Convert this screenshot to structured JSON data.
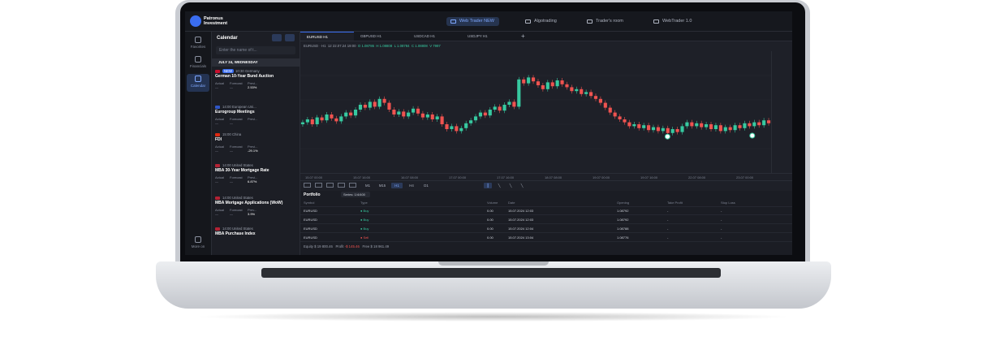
{
  "brand": {
    "line1": "Patronus",
    "line2": "Investment"
  },
  "nav_tabs": [
    {
      "label": "Web Trader NEW",
      "active": true
    },
    {
      "label": "Algotrading",
      "active": false
    },
    {
      "label": "Trader's room",
      "active": false
    },
    {
      "label": "WebTrader 1.0",
      "active": false
    }
  ],
  "rail": [
    {
      "label": "Favorites",
      "icon": "star-icon"
    },
    {
      "label": "Financials",
      "icon": "search-icon"
    },
    {
      "label": "Calendar",
      "icon": "calendar-icon",
      "active": true
    },
    {
      "label": "More on",
      "icon": "gear-icon"
    }
  ],
  "calendar": {
    "title": "Calendar",
    "search_placeholder": "Enter the name of t...",
    "date_label": "JULY 24, WEDNESDAY",
    "events": [
      {
        "time": "10:30",
        "badge": "NEW",
        "country": "Germany",
        "name": "German 10-Year Bund Auction",
        "actual": "Actual",
        "forecast": "Forecast",
        "prev": "Previ...",
        "prev_val": "2.53%",
        "flag": "#c8102e"
      },
      {
        "time": "14:00",
        "badge": "",
        "country": "European Uni...",
        "name": "Eurogroup Meetings",
        "actual": "Actual",
        "forecast": "Forecast",
        "prev": "Previ...",
        "prev_val": "",
        "flag": "#2f56c5"
      },
      {
        "time": "15:00",
        "badge": "",
        "country": "China",
        "name": "FDI",
        "actual": "Actual",
        "forecast": "Forecast",
        "prev": "Previ...",
        "prev_val": "-29.1%",
        "flag": "#de2910"
      },
      {
        "time": "14:00",
        "badge": "",
        "country": "United States",
        "name": "MBA 30-Year Mortgage Rate",
        "actual": "Actual",
        "forecast": "Forecast",
        "prev": "Previ...",
        "prev_val": "6.87%",
        "flag": "#b22234"
      },
      {
        "time": "14:00",
        "badge": "",
        "country": "United States",
        "name": "MBA Mortgage Applications (WoW)",
        "actual": "Actual",
        "forecast": "Forecast",
        "prev": "Prev...",
        "prev_val": "3.9%",
        "flag": "#b22234"
      },
      {
        "time": "14:00",
        "badge": "",
        "country": "United States",
        "name": "MBA Purchase Index",
        "actual": "",
        "forecast": "",
        "prev": "",
        "prev_val": "",
        "flag": "#b22234"
      }
    ]
  },
  "chart_tabs": [
    "EURUSD H1",
    "GBPUSD H1",
    "USDCAD H1",
    "USDJPY H1"
  ],
  "ohlc": {
    "symbol": "EURUSD · H1",
    "time": "12 22.07.24 19:00",
    "o": "O 1.08786",
    "h": "H 1.08808",
    "l": "L 1.08784",
    "c": "C 1.08808",
    "v": "V 7997"
  },
  "x_ticks": [
    "15.07 00:00",
    "15.07 16:00",
    "16.07 08:00",
    "17.07 00:00",
    "17.07 16:00",
    "18.07 08:00",
    "19.07 00:00",
    "19.07 16:00",
    "22.07 08:00",
    "23.07 00:00"
  ],
  "toolbar_tf": [
    "M1",
    "M15",
    "H1",
    "H4",
    "D1"
  ],
  "chart_data": {
    "type": "candlestick",
    "series": "EURUSD H1",
    "closes": [
      0.42,
      0.45,
      0.4,
      0.47,
      0.44,
      0.5,
      0.46,
      0.43,
      0.48,
      0.52,
      0.49,
      0.55,
      0.6,
      0.57,
      0.63,
      0.58,
      0.66,
      0.62,
      0.55,
      0.5,
      0.53,
      0.48,
      0.52,
      0.56,
      0.51,
      0.47,
      0.5,
      0.45,
      0.48,
      0.4,
      0.35,
      0.38,
      0.33,
      0.36,
      0.41,
      0.44,
      0.48,
      0.52,
      0.49,
      0.55,
      0.58,
      0.54,
      0.6,
      0.63,
      0.58,
      0.86,
      0.82,
      0.88,
      0.84,
      0.8,
      0.76,
      0.83,
      0.79,
      0.85,
      0.81,
      0.78,
      0.74,
      0.76,
      0.71,
      0.73,
      0.69,
      0.66,
      0.62,
      0.57,
      0.52,
      0.48,
      0.45,
      0.42,
      0.38,
      0.4,
      0.36,
      0.39,
      0.34,
      0.37,
      0.33,
      0.36,
      0.31,
      0.35,
      0.32,
      0.38,
      0.42,
      0.38,
      0.41,
      0.37,
      0.4,
      0.35,
      0.39,
      0.33,
      0.37,
      0.34,
      0.39,
      0.36,
      0.41,
      0.38,
      0.42,
      0.39,
      0.44,
      0.41
    ]
  },
  "portfolio": {
    "title": "Portfolio",
    "select": "Series: 1/4/400",
    "headers": [
      "Symbol",
      "Type",
      "Volume",
      "Date",
      "Opening",
      "Take Profit",
      "Stop Loss"
    ],
    "rows": [
      {
        "symbol": "EURUSD",
        "type": "Buy",
        "volume": "0.00",
        "date": "15.07.2024 12:03",
        "opening": "1.08792",
        "tp": "-",
        "sl": "-"
      },
      {
        "symbol": "EURUSD",
        "type": "Buy",
        "volume": "0.00",
        "date": "15.07.2024 12:03",
        "opening": "1.08792",
        "tp": "-",
        "sl": "-"
      },
      {
        "symbol": "EURUSD",
        "type": "Buy",
        "volume": "0.00",
        "date": "15.07.2024 12:04",
        "opening": "1.08788",
        "tp": "-",
        "sl": "-"
      },
      {
        "symbol": "EURUSD",
        "type": "Sell",
        "volume": "0.00",
        "date": "15.07.2024 13:04",
        "opening": "1.08776",
        "tp": "-",
        "sl": "-"
      }
    ],
    "footer": {
      "equity": "Equity $ 19 800.46",
      "profit_label": "Profit",
      "profit": "-$ 145.46",
      "free": "Free $ 18 961.49"
    }
  },
  "colors": {
    "accent": "#3a6df0",
    "up": "#37c9a0",
    "down": "#ef5350"
  }
}
